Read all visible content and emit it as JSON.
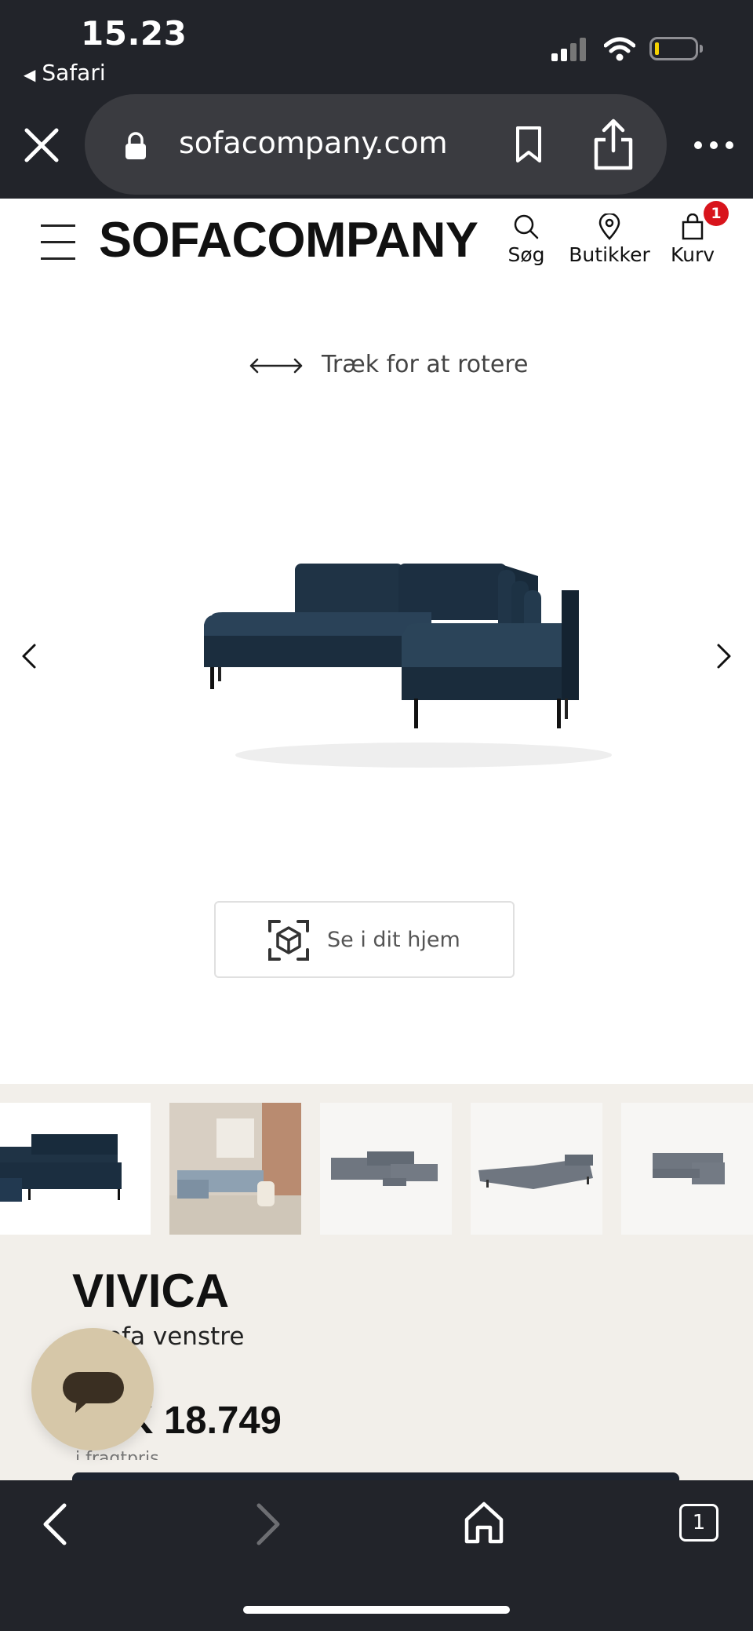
{
  "status_bar": {
    "time": "15.23",
    "back_app": "Safari"
  },
  "browser": {
    "url": "sofacompany.com",
    "tab_count": "1"
  },
  "site_header": {
    "logo": "SOFACOMPANY",
    "search_label": "Søg",
    "stores_label": "Butikker",
    "cart_label": "Kurv",
    "cart_count": "1"
  },
  "viewer": {
    "rotate_hint": "Træk for at rotere",
    "ar_button": "Se i dit hjem"
  },
  "product": {
    "name": "VIVICA",
    "type": "sofa venstre",
    "price": "K 18.749",
    "price_note": "i fragtpris"
  },
  "thumbnails": [
    "sofa-front",
    "sofa-room",
    "sofa-grey-1",
    "sofa-grey-2",
    "sofa-grey-3"
  ],
  "colors": {
    "browser_chrome": "#22242a",
    "sofa": "#1f3345",
    "badge": "#d8141c",
    "panel": "#f2efea",
    "chat": "#d6c7a8"
  }
}
